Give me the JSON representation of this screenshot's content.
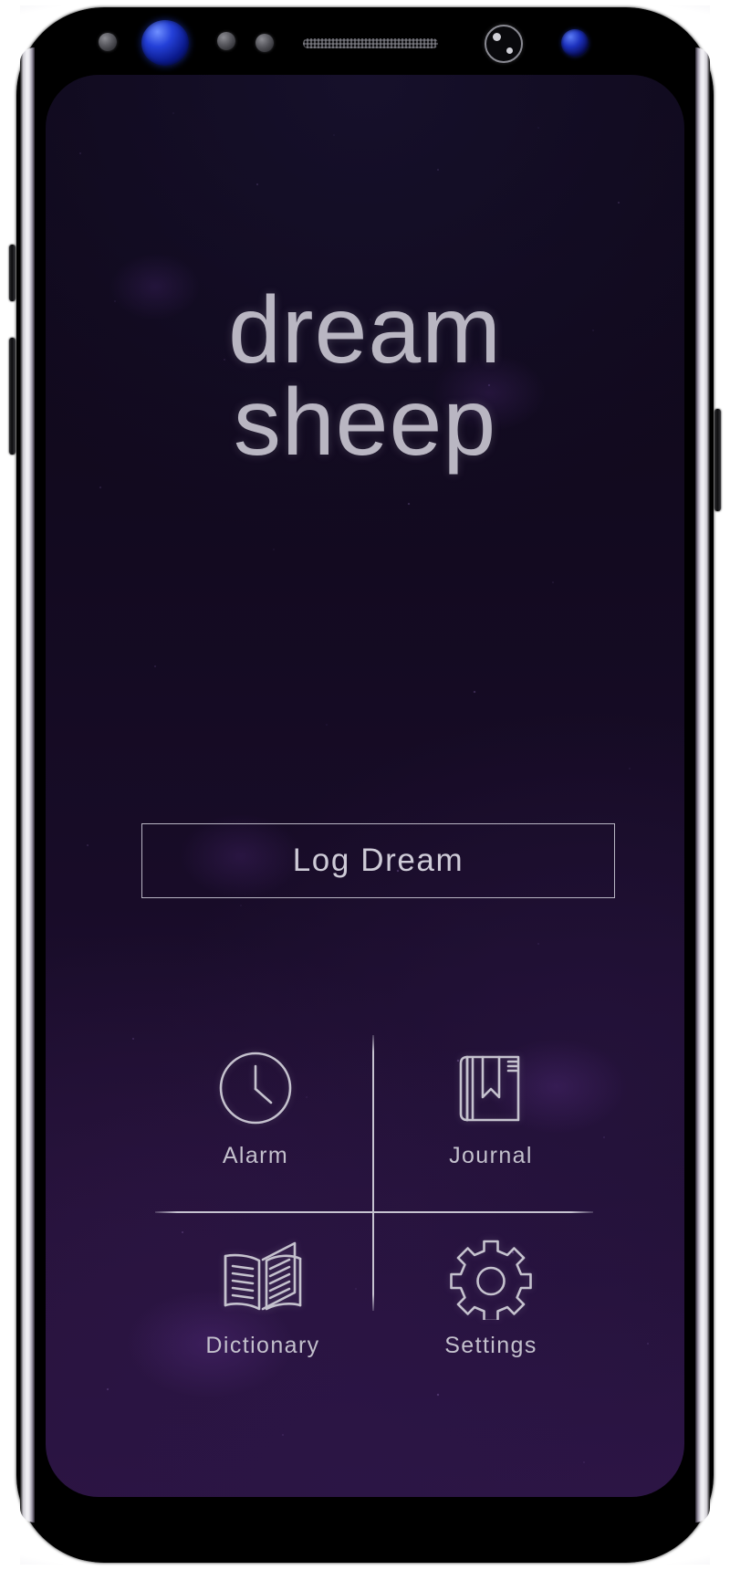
{
  "app": {
    "logo_line1": "dream",
    "logo_line2": "sheep",
    "primary_button_label": "Log Dream",
    "colors": {
      "screen_background_top": "#0e0819",
      "screen_background_bottom": "#2d1545",
      "logo_text": "#b9b6c2",
      "button_border": "#b8b5c3",
      "button_text": "#cecbd7",
      "divider": "#c6c3d0",
      "icon_stroke": "#c5c2ce",
      "label_text": "#c3c0cc"
    }
  },
  "menu": {
    "items": [
      {
        "label": "Alarm",
        "icon": "clock-icon"
      },
      {
        "label": "Journal",
        "icon": "closed-book-bookmark-icon"
      },
      {
        "label": "Dictionary",
        "icon": "open-book-icon"
      },
      {
        "label": "Settings",
        "icon": "gear-icon"
      }
    ]
  },
  "device": {
    "sensors": [
      "proximity-sensor-dot",
      "iris-scanner",
      "sensor-dot",
      "sensor-dot",
      "earpiece-speaker-grille",
      "ir-sensor-ring",
      "front-camera"
    ],
    "buttons": [
      "bixby-button",
      "volume-button",
      "power-button"
    ]
  }
}
